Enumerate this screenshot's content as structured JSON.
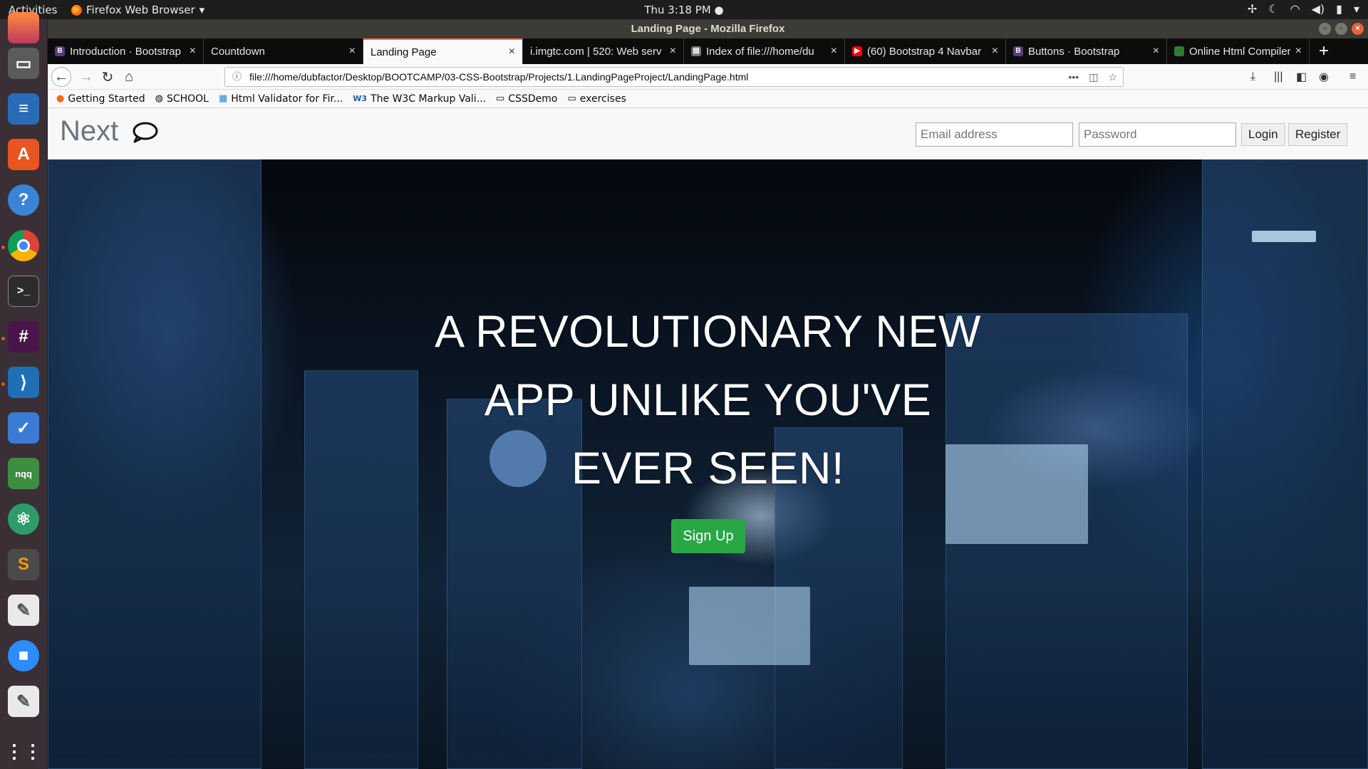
{
  "system": {
    "activities": "Activities",
    "app_name": "Firefox Web Browser",
    "clock": "Thu  3:18 PM"
  },
  "window": {
    "title": "Landing Page - Mozilla Firefox"
  },
  "tabs": [
    {
      "label": "Introduction · Bootstrap",
      "favicon": "B",
      "color": "#563d7c"
    },
    {
      "label": "Countdown",
      "favicon": "",
      "color": ""
    },
    {
      "label": "Landing Page",
      "favicon": "",
      "color": ""
    },
    {
      "label": "i.imgtc.com | 520: Web serv",
      "favicon": "",
      "color": ""
    },
    {
      "label": "Index of file:///home/du",
      "favicon": "▤",
      "color": "#777"
    },
    {
      "label": "(60) Bootstrap 4 Navbar",
      "favicon": "▶",
      "color": "#ff0000"
    },
    {
      "label": "Buttons · Bootstrap",
      "favicon": "B",
      "color": "#563d7c"
    },
    {
      "label": "Online Html Compiler - C",
      "favicon": "",
      "color": "#2e7d32"
    }
  ],
  "nav": {
    "url": "file:///home/dubfactor/Desktop/BOOTCAMP/03-CSS-Bootstrap/Projects/1.LandingPageProject/LandingPage.html"
  },
  "bookmarks": [
    {
      "label": "Getting Started",
      "icon": "●"
    },
    {
      "label": "SCHOOL",
      "icon": "◍"
    },
    {
      "label": "Html Validator for Fir...",
      "icon": "▦"
    },
    {
      "label": "The W3C Markup Vali...",
      "icon": "W3"
    },
    {
      "label": "CSSDemo",
      "icon": "▭"
    },
    {
      "label": "exercises",
      "icon": "▭"
    }
  ],
  "site": {
    "brand": "Next",
    "email_placeholder": "Email address",
    "password_placeholder": "Password",
    "login": "Login",
    "register": "Register",
    "hero_lines": [
      "A REVOLUTIONARY NEW",
      "APP UNLIKE YOU'VE",
      "EVER SEEN!"
    ],
    "signup": "Sign Up"
  },
  "colors": {
    "accent_tab": "#ff7139",
    "signup": "#28a745",
    "ubuntu_orange": "#e95420"
  }
}
